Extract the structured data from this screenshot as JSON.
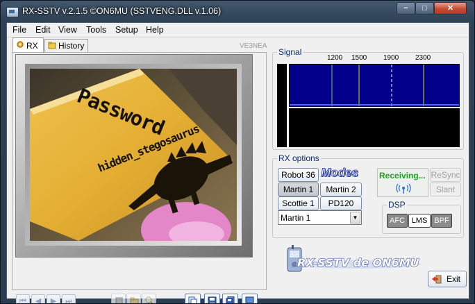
{
  "window": {
    "title": "RX-SSTV v.2.1.5 ©ON6MU (SSTVENG.DLL v.1.06)",
    "minimize": "−",
    "maximize": "□",
    "close": "✕"
  },
  "menu": [
    "File",
    "Edit",
    "View",
    "Tools",
    "Setup",
    "Help"
  ],
  "tabs": [
    {
      "label": "RX",
      "icon": "gear-icon"
    },
    {
      "label": "History",
      "icon": "history-icon"
    }
  ],
  "callsign": "VE3NEA",
  "received_image": {
    "line1": "Password",
    "line2": "hidden_stegosaurus"
  },
  "signal": {
    "label": "Signal",
    "freq_labels": [
      "1200",
      "1500",
      "1900",
      "2300"
    ]
  },
  "rx_options": {
    "label": "RX options",
    "modes_logo": "Modes",
    "mode_buttons": [
      "Robot 36",
      "Martin 1",
      "Martin 2",
      "Scottie 1",
      "PD120"
    ],
    "selected_mode": "Martin 1",
    "status": "Receiving...",
    "resync": "ReSync",
    "slant": "Slant"
  },
  "dsp": {
    "label": "DSP",
    "buttons": [
      "AFC",
      "LMS",
      "BPF"
    ]
  },
  "logo_text": "RX-SSTV de ON6MU",
  "exit_label": "Exit",
  "colors": {
    "accent": "#1b59b7",
    "status_green": "#16a51a",
    "spectrum_bg": "#00008a",
    "marker_green": "#6fd14a",
    "marker_yellow": "#e0e000"
  }
}
